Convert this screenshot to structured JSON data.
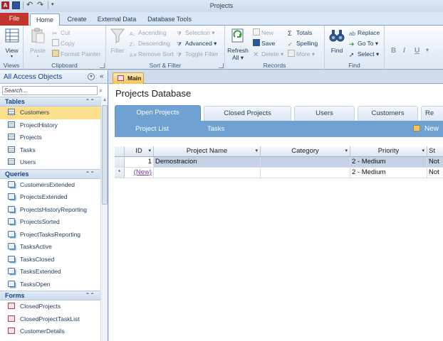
{
  "window": {
    "title": "Projects",
    "qat": {
      "app_icon": "A",
      "icons": [
        "access-icon",
        "save-icon",
        "undo-icon",
        "redo-icon",
        "customize-icon"
      ]
    }
  },
  "ribbon_tabs": {
    "file": "File",
    "home": "Home",
    "create": "Create",
    "external": "External Data",
    "dbtools": "Database Tools"
  },
  "ribbon": {
    "views": {
      "label": "Views",
      "view": "View"
    },
    "clipboard": {
      "label": "Clipboard",
      "paste": "Paste",
      "cut": "Cut",
      "copy": "Copy",
      "format_painter": "Format Painter"
    },
    "sort_filter": {
      "label": "Sort & Filter",
      "filter": "Filter",
      "ascending": "Ascending",
      "descending": "Descending",
      "remove_sort": "Remove Sort",
      "selection": "Selection",
      "advanced": "Advanced",
      "toggle_filter": "Toggle Filter"
    },
    "records": {
      "label": "Records",
      "refresh": "Refresh",
      "refresh_all": "All",
      "new": "New",
      "save": "Save",
      "delete": "Delete",
      "totals": "Totals",
      "spelling": "Spelling",
      "more": "More"
    },
    "find": {
      "label": "Find",
      "find": "Find",
      "replace": "Replace",
      "goto": "Go To",
      "select": "Select"
    },
    "formatting": {
      "bold": "B",
      "italic": "I",
      "underline": "U"
    }
  },
  "nav_pane": {
    "title": "All Access Objects",
    "search_placeholder": "Search...",
    "sections": [
      {
        "name": "Tables",
        "items": [
          "Customers",
          "ProjectHistory",
          "Projects",
          "Tasks",
          "Users"
        ]
      },
      {
        "name": "Queries",
        "items": [
          "CustomersExtended",
          "ProjectsExtended",
          "ProjectsHistoryReporting",
          "ProjectsSorted",
          "ProjectTasksReporting",
          "TasksActive",
          "TasksClosed",
          "TasksExtended",
          "TasksOpen"
        ]
      },
      {
        "name": "Forms",
        "items": [
          "ClosedProjects",
          "ClosedProjectTaskList",
          "CustomerDetails"
        ]
      }
    ],
    "selected_item": "Customers"
  },
  "document": {
    "tab_label": "Main",
    "page_title": "Projects Database",
    "main_tabs": [
      "Open Projects",
      "Closed Projects",
      "Users",
      "Customers",
      "Re"
    ],
    "active_main_tab": "Open Projects",
    "sub_tabs": [
      "Project List",
      "Tasks"
    ],
    "new_button": "New",
    "grid": {
      "columns": [
        "ID",
        "Project Name",
        "Category",
        "Priority",
        "St"
      ],
      "rows": [
        {
          "selector": "",
          "id": "1",
          "name": "Demostracion",
          "category": "",
          "priority": "2 - Medium",
          "status": "Not"
        },
        {
          "selector": "*",
          "id": "(New)",
          "name": "",
          "category": "",
          "priority": "2 - Medium",
          "status": "Not"
        }
      ]
    }
  },
  "colors": {
    "file_tab": "#c4362d",
    "accent_blue": "#6fa1d2",
    "selection": "#fde08d",
    "doc_tab": "#f7c356"
  }
}
